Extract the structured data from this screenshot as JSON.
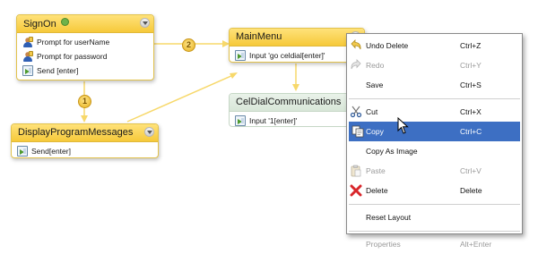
{
  "nodes": {
    "signon": {
      "title": "SignOn",
      "items": [
        {
          "icon": "person-icon",
          "label": "Prompt for userName"
        },
        {
          "icon": "person-icon",
          "label": "Prompt for password"
        },
        {
          "icon": "send-icon",
          "label": "Send [enter]"
        }
      ]
    },
    "display_program_messages": {
      "title": "DisplayProgramMessages",
      "items": [
        {
          "icon": "send-icon",
          "label": "Send[enter]"
        }
      ]
    },
    "main_menu": {
      "title": "MainMenu",
      "items": [
        {
          "icon": "send-icon",
          "label": "Input 'go celdial[enter]'"
        }
      ]
    },
    "cel_dial_communications": {
      "title": "CelDialCommunications",
      "items": [
        {
          "icon": "send-icon",
          "label": "Input '1[enter]'"
        }
      ]
    }
  },
  "connectors": {
    "badge_1": "1",
    "badge_2": "2"
  },
  "context_menu": {
    "items": [
      {
        "label": "Undo Delete",
        "shortcut": "Ctrl+Z",
        "icon": "undo-icon",
        "state": "enabled"
      },
      {
        "label": "Redo",
        "shortcut": "Ctrl+Y",
        "icon": "redo-icon",
        "state": "disabled"
      },
      {
        "label": "Save",
        "shortcut": "Ctrl+S",
        "icon": "",
        "state": "enabled"
      },
      {
        "label": "Cut",
        "shortcut": "Ctrl+X",
        "icon": "scissors-icon",
        "state": "enabled"
      },
      {
        "label": "Copy",
        "shortcut": "Ctrl+C",
        "icon": "copy-icon",
        "state": "selected"
      },
      {
        "label": "Copy As Image",
        "shortcut": "",
        "icon": "",
        "state": "enabled"
      },
      {
        "label": "Paste",
        "shortcut": "Ctrl+V",
        "icon": "paste-icon",
        "state": "disabled"
      },
      {
        "label": "Delete",
        "shortcut": "Delete",
        "icon": "delete-icon",
        "state": "enabled"
      },
      {
        "label": "Reset Layout",
        "shortcut": "",
        "icon": "",
        "state": "enabled"
      },
      {
        "label": "Properties",
        "shortcut": "Alt+Enter",
        "icon": "",
        "state": "disabled"
      }
    ]
  },
  "colors": {
    "node_header": "#f6c93a",
    "node_border": "#e2c24c",
    "connector": "#f5d76e",
    "menu_selected": "#3d6fc3",
    "delete_red": "#d8262b"
  }
}
